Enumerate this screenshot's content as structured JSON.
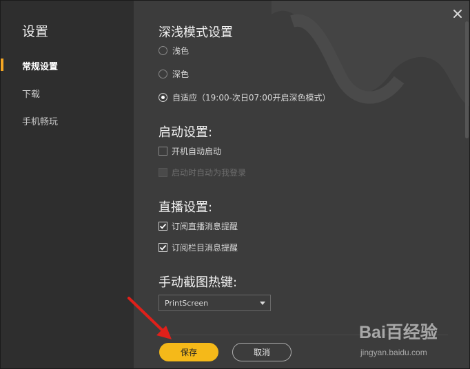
{
  "sidebar": {
    "title": "设置",
    "items": [
      {
        "label": "常规设置",
        "active": true
      },
      {
        "label": "下载",
        "active": false
      },
      {
        "label": "手机畅玩",
        "active": false
      }
    ]
  },
  "theme": {
    "title": "深浅模式设置",
    "options": [
      {
        "label": "浅色",
        "checked": false
      },
      {
        "label": "深色",
        "checked": false
      },
      {
        "label": "自适应（19:00-次日07:00开启深色模式）",
        "checked": true
      }
    ]
  },
  "startup": {
    "title": "启动设置:",
    "options": [
      {
        "label": "开机自动启动",
        "checked": false,
        "disabled": false
      },
      {
        "label": "启动时自动为我登录",
        "checked": false,
        "disabled": true
      }
    ]
  },
  "live": {
    "title": "直播设置:",
    "options": [
      {
        "label": "订阅直播消息提醒",
        "checked": true
      },
      {
        "label": "订阅栏目消息提醒",
        "checked": true
      }
    ]
  },
  "hotkey": {
    "title": "手动截图热键:",
    "value": "PrintScreen"
  },
  "footer": {
    "save_label": "保存",
    "cancel_label": "取消"
  },
  "watermark": {
    "logo": "Bai百经验",
    "url": "jingyan.baidu.com"
  },
  "colors": {
    "accent": "#f5b919",
    "annotation_arrow": "#e0201a"
  }
}
